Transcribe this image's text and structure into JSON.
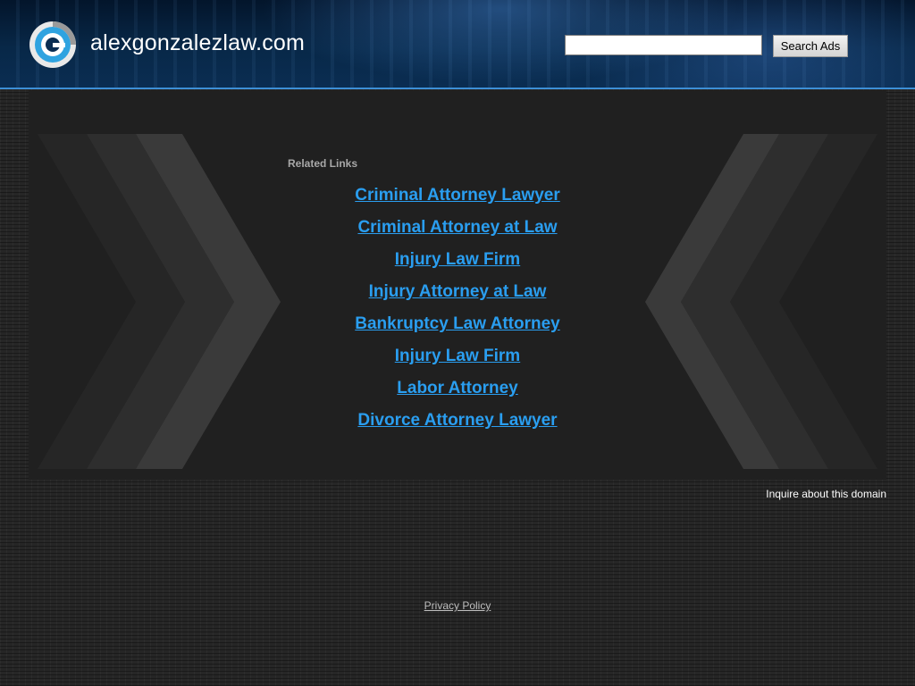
{
  "header": {
    "site_name": "alexgonzalezlaw.com",
    "search_placeholder": "",
    "search_button": "Search Ads"
  },
  "related": {
    "heading": "Related Links",
    "links": [
      "Criminal Attorney Lawyer",
      "Criminal Attorney at Law",
      "Injury Law Firm",
      "Injury Attorney at Law",
      "Bankruptcy Law Attorney",
      "Injury Law Firm",
      "Labor Attorney",
      "Divorce Attorney Lawyer"
    ]
  },
  "footer": {
    "inquire": "Inquire about this domain",
    "privacy": "Privacy Policy"
  },
  "colors": {
    "link": "#2a9ef0",
    "header_border": "#3d8fd6",
    "panel": "#202020"
  },
  "icons": {
    "logo": "search-logo-icon",
    "decoration": "chevron-icon"
  }
}
